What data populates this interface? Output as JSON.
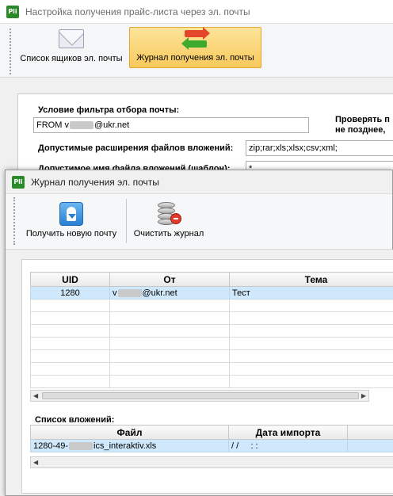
{
  "back_window": {
    "app_icon": "Pli",
    "title": "Настройка получения прайс-листа через эл. почты",
    "toolbar": {
      "mailboxes_label": "Список ящиков эл. почты",
      "mail_log_label": "Журнал получения эл. почты"
    },
    "form": {
      "filter_label": "Условие фильтра отбора почты:",
      "filter_value_prefix": "FROM v",
      "filter_value_suffix": "@ukr.net",
      "check_label_line1": "Проверять п",
      "check_label_line2": "не позднее,",
      "extensions_label": "Допустимые расширения файлов вложений:",
      "extensions_value": "zip;rar;xls;xlsx;csv;xml;",
      "filename_label": "Допустимое имя файла вложений (шаблон):",
      "filename_value": "*"
    }
  },
  "front_window": {
    "app_icon": "Pli",
    "title": "Журнал получения эл. почты",
    "toolbar": {
      "get_mail_label": "Получить новую почту",
      "clear_log_label": "Очистить журнал"
    },
    "messages_table": {
      "headers": [
        "UID",
        "От",
        "Тема"
      ],
      "rows": [
        {
          "uid": "1280",
          "from_prefix": "v",
          "from_suffix": "@ukr.net",
          "subject": "Тест"
        }
      ]
    },
    "attachments_label": "Список вложений:",
    "attachments_table": {
      "headers": [
        "Файл",
        "Дата импорта"
      ],
      "rows": [
        {
          "file_prefix": "1280-49-",
          "file_suffix": "ics_interaktiv.xls",
          "date": "/ /     : :"
        }
      ]
    }
  },
  "icons": [
    "envelope-icon",
    "swap-arrows-icon",
    "download-mail-icon",
    "database-clear-icon"
  ]
}
